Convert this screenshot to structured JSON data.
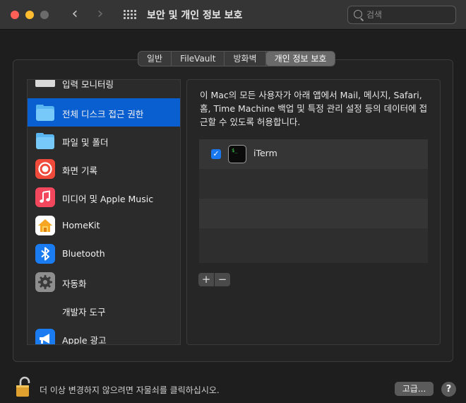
{
  "window": {
    "title": "보안 및 개인 정보 보호",
    "traffic_lights": [
      "close",
      "minimize",
      "zoom"
    ]
  },
  "toolbar": {
    "back_icon": "chevron-left-icon",
    "forward_icon": "chevron-right-icon",
    "show_all_icon": "grid-icon"
  },
  "search": {
    "placeholder": "검색",
    "value": ""
  },
  "tabs": [
    {
      "label": "일반",
      "active": false
    },
    {
      "label": "FileVault",
      "active": false
    },
    {
      "label": "방화벽",
      "active": false
    },
    {
      "label": "개인 정보 보호",
      "active": true
    }
  ],
  "sidebar": {
    "items": [
      {
        "label": "입력 모니터링",
        "icon": "keyboard-icon",
        "selected": false
      },
      {
        "label": "전체 디스크 접근 권한",
        "icon": "folder-icon",
        "selected": true
      },
      {
        "label": "파일 및 폴더",
        "icon": "folder-icon",
        "selected": false
      },
      {
        "label": "화면 기록",
        "icon": "screen-recording-icon",
        "selected": false
      },
      {
        "label": "미디어 및 Apple Music",
        "icon": "music-note-icon",
        "selected": false
      },
      {
        "label": "HomeKit",
        "icon": "home-icon",
        "selected": false
      },
      {
        "label": "Bluetooth",
        "icon": "bluetooth-icon",
        "selected": false
      },
      {
        "label": "자동화",
        "icon": "gear-icon",
        "selected": false
      },
      {
        "label": "개발자 도구",
        "icon": "",
        "selected": false
      },
      {
        "label": "Apple 광고",
        "icon": "megaphone-icon",
        "selected": false
      }
    ]
  },
  "main": {
    "description": "이 Mac의 모든 사용자가 아래 앱에서 Mail, 메시지, Safari, 홈, Time Machine 백업 및 특정 관리 설정 등의 데이터에 접근할 수 있도록 허용합니다.",
    "apps": [
      {
        "name": "iTerm",
        "checked": true,
        "icon": "terminal-icon"
      }
    ],
    "add_label": "+",
    "remove_label": "−"
  },
  "footer": {
    "lock_text": "더 이상 변경하지 않으려면 자물쇠를 클릭하십시오.",
    "advanced_label": "고급...",
    "help_label": "?"
  },
  "colors": {
    "accent": "#0a5fd0",
    "checkbox": "#1a78f0",
    "folder": "#59b6f0"
  }
}
